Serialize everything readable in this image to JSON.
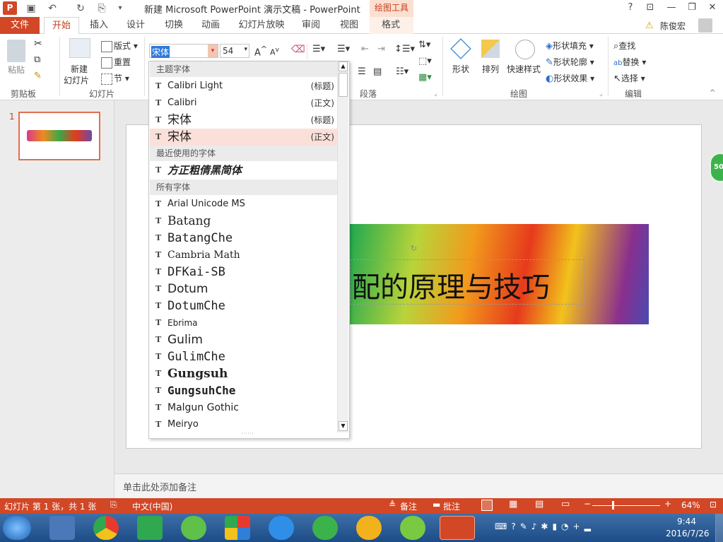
{
  "window": {
    "title": "新建 Microsoft PowerPoint 演示文稿 - PowerPoint",
    "contextual_group": "绘图工具",
    "help": "?",
    "user": "陈俊宏"
  },
  "tabs": [
    "文件",
    "开始",
    "插入",
    "设计",
    "切换",
    "动画",
    "幻灯片放映",
    "审阅",
    "视图",
    "格式"
  ],
  "ribbon": {
    "clipboard": {
      "paste": "粘贴",
      "label": "剪贴板"
    },
    "slides": {
      "new_slide_1": "新建",
      "new_slide_2": "幻灯片",
      "layout": "版式",
      "reset": "重置",
      "section": "节",
      "label": "幻灯片"
    },
    "font": {
      "name_value": "宋体",
      "size_value": "54"
    },
    "paragraph": {
      "label": "段落"
    },
    "drawing": {
      "shapes": "形状",
      "arrange": "排列",
      "quick_styles": "快速样式",
      "fill": "形状填充",
      "outline": "形状轮廓",
      "effects": "形状效果",
      "label": "绘图"
    },
    "editing": {
      "find": "查找",
      "replace": "替换",
      "select": "选择",
      "label": "编辑"
    }
  },
  "font_dropdown": {
    "theme_header": "主题字体",
    "theme_fonts": [
      {
        "name": "Calibri Light",
        "tag": "(标题)"
      },
      {
        "name": "Calibri",
        "tag": "(正文)"
      },
      {
        "name": "宋体",
        "tag": "(标题)"
      },
      {
        "name": "宋体",
        "tag": "(正文)"
      }
    ],
    "recent_header": "最近使用的字体",
    "recent_fonts": [
      "方正粗倩黑简体"
    ],
    "all_header": "所有字体",
    "all_fonts": [
      "Arial Unicode MS",
      "Batang",
      "BatangChe",
      "Cambria Math",
      "DFKai-SB",
      "Dotum",
      "DotumChe",
      "Ebrima",
      "Gulim",
      "GulimChe",
      "Gungsuh",
      "GungsuhChe",
      "Malgun Gothic",
      "Meiryo"
    ]
  },
  "slide": {
    "number": "1",
    "title_text": "配的原理与技巧",
    "badge": "50",
    "notes_placeholder": "单击此处添加备注"
  },
  "status": {
    "slide_info": "幻灯片 第 1 张，共 1 张",
    "language": "中文(中国)",
    "notes": "备注",
    "comments": "批注",
    "zoom": "64%"
  },
  "taskbar": {
    "time": "9:44",
    "date": "2016/7/26"
  },
  "colors": {
    "accent": "#d24726",
    "selected_row": "#fbe0d9"
  }
}
